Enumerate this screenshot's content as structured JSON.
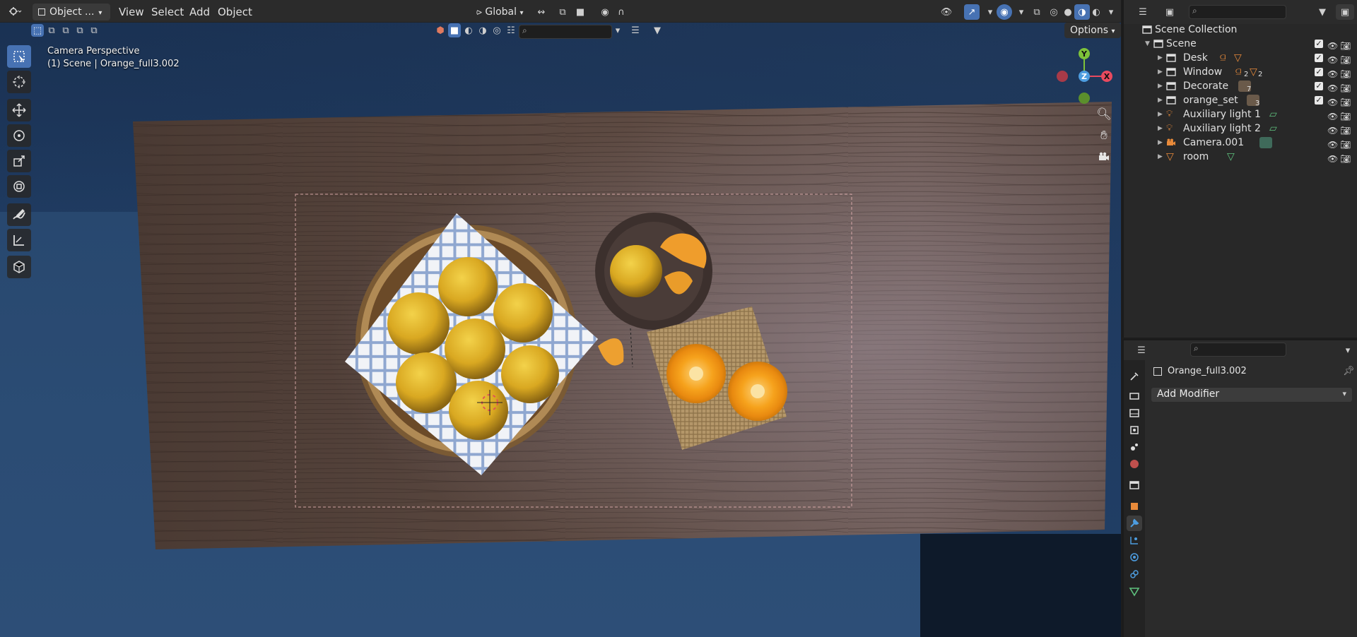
{
  "header": {
    "mode": "Object ...",
    "menus": [
      "View",
      "Select",
      "Add",
      "Object"
    ],
    "transform_orientation": "Global",
    "options_label": "Options"
  },
  "viewport": {
    "camera_label": "Camera Perspective",
    "scene_label": "(1) Scene | Orange_full3.002",
    "gizmo": {
      "x": "X",
      "y": "Y",
      "z": "Z"
    }
  },
  "outliner": {
    "root": "Scene Collection",
    "scene": "Scene",
    "items": [
      {
        "label": "Desk",
        "type": "collection"
      },
      {
        "label": "Window",
        "type": "collection",
        "badge1": "2",
        "badge2": "2"
      },
      {
        "label": "Decorate",
        "type": "collection",
        "badge1": "7"
      },
      {
        "label": "orange_set",
        "type": "collection",
        "badge1": "3"
      },
      {
        "label": "Auxiliary light 1",
        "type": "light"
      },
      {
        "label": "Auxiliary light 2",
        "type": "light"
      },
      {
        "label": "Camera.001",
        "type": "camera"
      },
      {
        "label": "room",
        "type": "mesh"
      }
    ]
  },
  "properties": {
    "object_name": "Orange_full3.002",
    "add_modifier_label": "Add Modifier"
  },
  "colors": {
    "accent": "#4772b3",
    "x_axis": "#e84a5f",
    "y_axis": "#7ec33a",
    "z_axis": "#4d9de0",
    "collection_icon": "#e0e0e0",
    "object_orange": "#e88a3a",
    "mesh_green": "#5fc27e"
  }
}
